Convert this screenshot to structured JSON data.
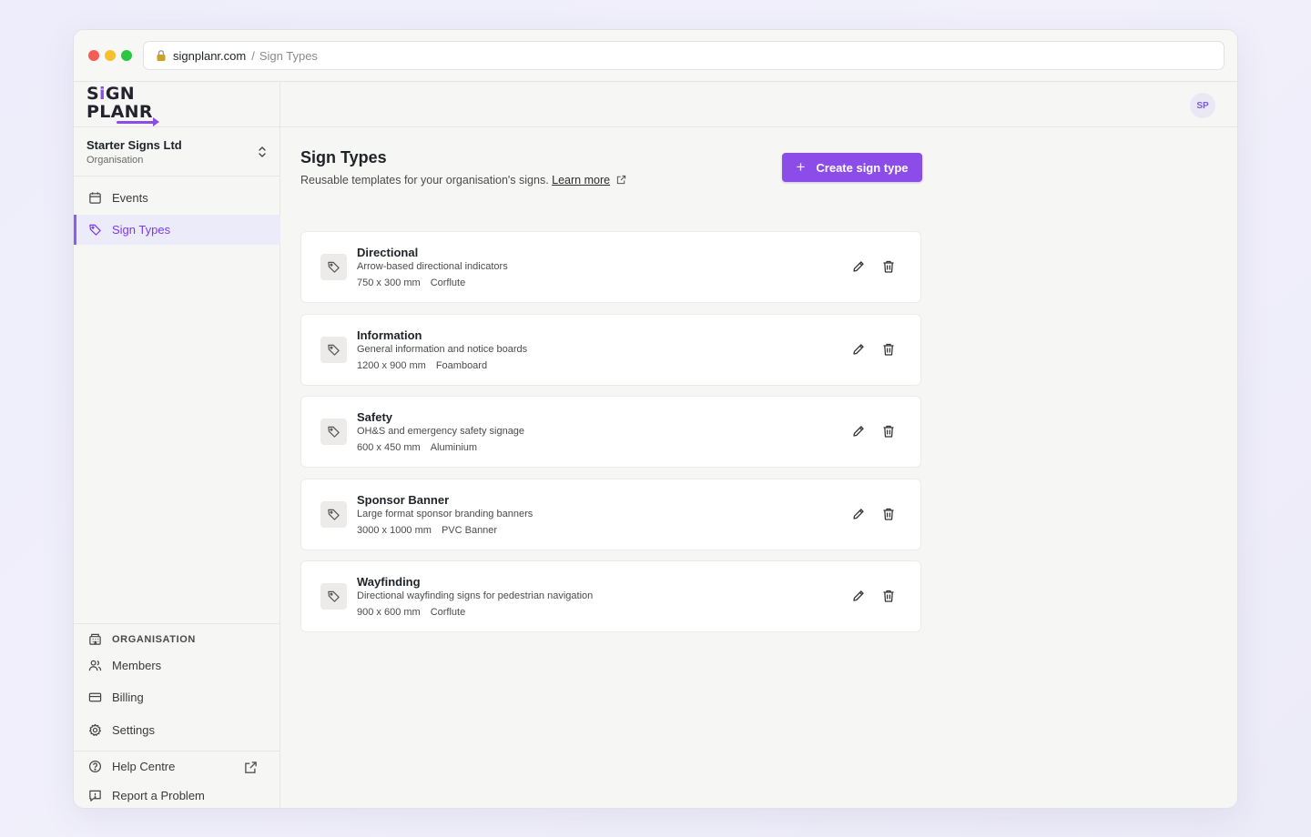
{
  "browser": {
    "url_domain": "signplanr.com",
    "url_separator": "/",
    "url_path": "Sign Types"
  },
  "sidebar": {
    "logo": {
      "line1": "SiGN",
      "line2": "PLANR"
    },
    "org": {
      "name": "Starter Signs Ltd",
      "subtitle": "Organisation"
    },
    "nav": [
      {
        "label": "Events",
        "icon": "calendar-icon",
        "active": false
      },
      {
        "label": "Sign Types",
        "icon": "tag-icon",
        "active": true
      }
    ],
    "org_section": {
      "label": "ORGANISATION",
      "items": [
        {
          "label": "Members",
          "icon": "users-icon"
        },
        {
          "label": "Billing",
          "icon": "credit-card-icon"
        },
        {
          "label": "Settings",
          "icon": "gear-icon"
        }
      ]
    },
    "footer": [
      {
        "label": "Help Centre",
        "icon": "help-circle-icon",
        "external": true
      },
      {
        "label": "Report a Problem",
        "icon": "message-alert-icon",
        "external": false
      }
    ]
  },
  "topbar": {
    "avatar_initials": "SP"
  },
  "page": {
    "title": "Sign Types",
    "subtitle": "Reusable templates for your organisation's signs.",
    "learn_more": "Learn more",
    "create_button": "Create sign type",
    "create_icon": "+"
  },
  "sign_types": [
    {
      "name": "Directional",
      "description": "Arrow-based directional indicators",
      "size": "750 x 300 mm",
      "material": "Corflute"
    },
    {
      "name": "Information",
      "description": "General information and notice boards",
      "size": "1200 x 900 mm",
      "material": "Foamboard"
    },
    {
      "name": "Safety",
      "description": "OH&S and emergency safety signage",
      "size": "600 x 450 mm",
      "material": "Aluminium"
    },
    {
      "name": "Sponsor Banner",
      "description": "Large format sponsor branding banners",
      "size": "3000 x 1000 mm",
      "material": "PVC Banner"
    },
    {
      "name": "Wayfinding",
      "description": "Directional wayfinding signs for pedestrian navigation",
      "size": "900 x 600 mm",
      "material": "Corflute"
    }
  ],
  "colors": {
    "accent": "#8b4ce8",
    "active_bg": "#ecebf9",
    "page_bg": "#f6f6f5"
  }
}
